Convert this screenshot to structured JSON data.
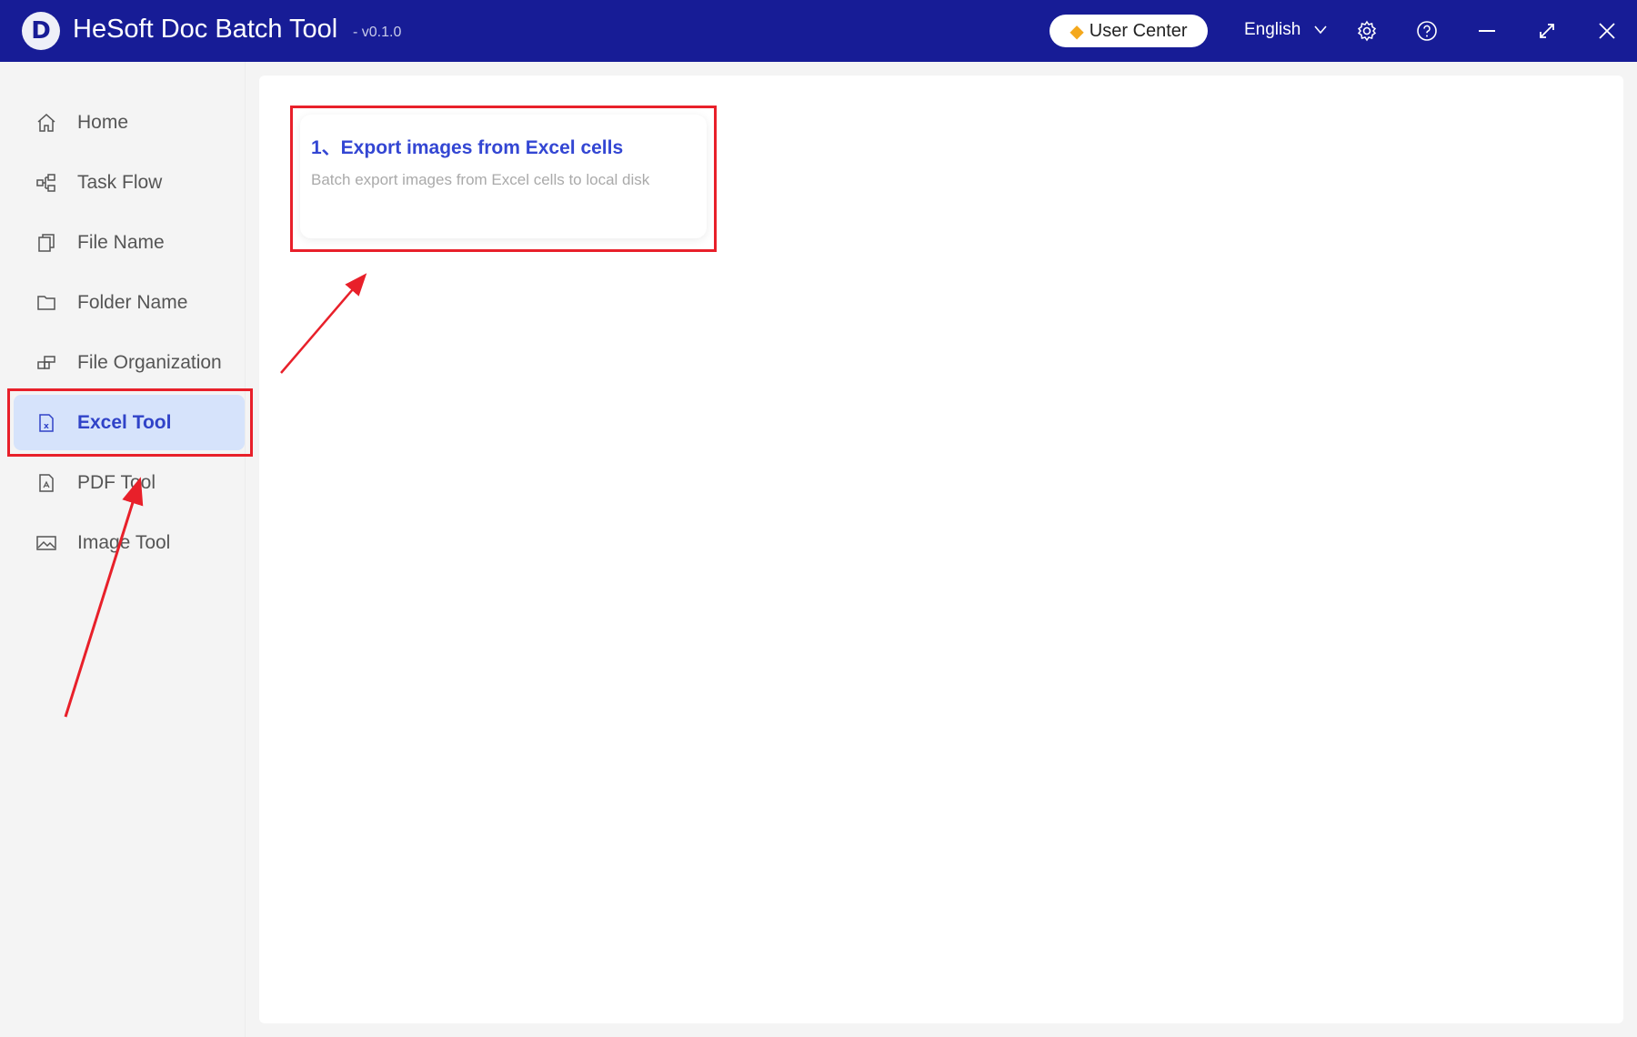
{
  "titlebar": {
    "logo_letter": "D",
    "title": "HeSoft Doc Batch Tool",
    "version": "- v0.1.0",
    "user_center": "User Center",
    "language": "English"
  },
  "sidebar": {
    "items": [
      {
        "label": "Home",
        "icon": "home-icon"
      },
      {
        "label": "Task Flow",
        "icon": "task-flow-icon"
      },
      {
        "label": "File Name",
        "icon": "file-name-icon"
      },
      {
        "label": "Folder Name",
        "icon": "folder-icon"
      },
      {
        "label": "File Organization",
        "icon": "file-organization-icon"
      },
      {
        "label": "Excel Tool",
        "icon": "excel-file-icon",
        "active": true
      },
      {
        "label": "PDF Tool",
        "icon": "pdf-file-icon"
      },
      {
        "label": "Image Tool",
        "icon": "image-icon"
      }
    ]
  },
  "main": {
    "cards": [
      {
        "title": "1、Export images from Excel cells",
        "description": "Batch export images from Excel cells to local disk"
      }
    ]
  },
  "colors": {
    "titlebar": "#171c96",
    "accent": "#3346d3",
    "annotation": "#e8202a"
  }
}
